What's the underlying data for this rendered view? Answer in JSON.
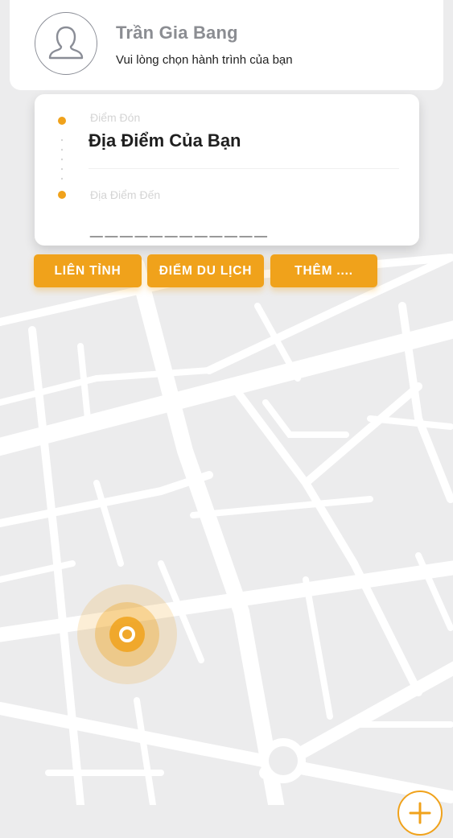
{
  "header": {
    "user_name": "Trần Gia Bang",
    "subtitle": "Vui lòng chọn hành trình của bạn",
    "avatar_icon": "user-icon"
  },
  "route": {
    "pickup_label": "Điểm Đón",
    "pickup_value": "Địa Điểm Của Bạn",
    "destination_label": "Địa Điểm Đến",
    "destination_value": "____________"
  },
  "quick_actions": [
    {
      "label": "LIÊN TỈNH"
    },
    {
      "label": "ĐIỂM DU LỊCH"
    },
    {
      "label": "THÊM ...."
    }
  ],
  "colors": {
    "accent": "#f0a21b",
    "map_background": "#ececed",
    "road": "#ffffff"
  },
  "map": {
    "current_location_icon": "location-pin-icon",
    "fab_icon": "add-icon"
  }
}
